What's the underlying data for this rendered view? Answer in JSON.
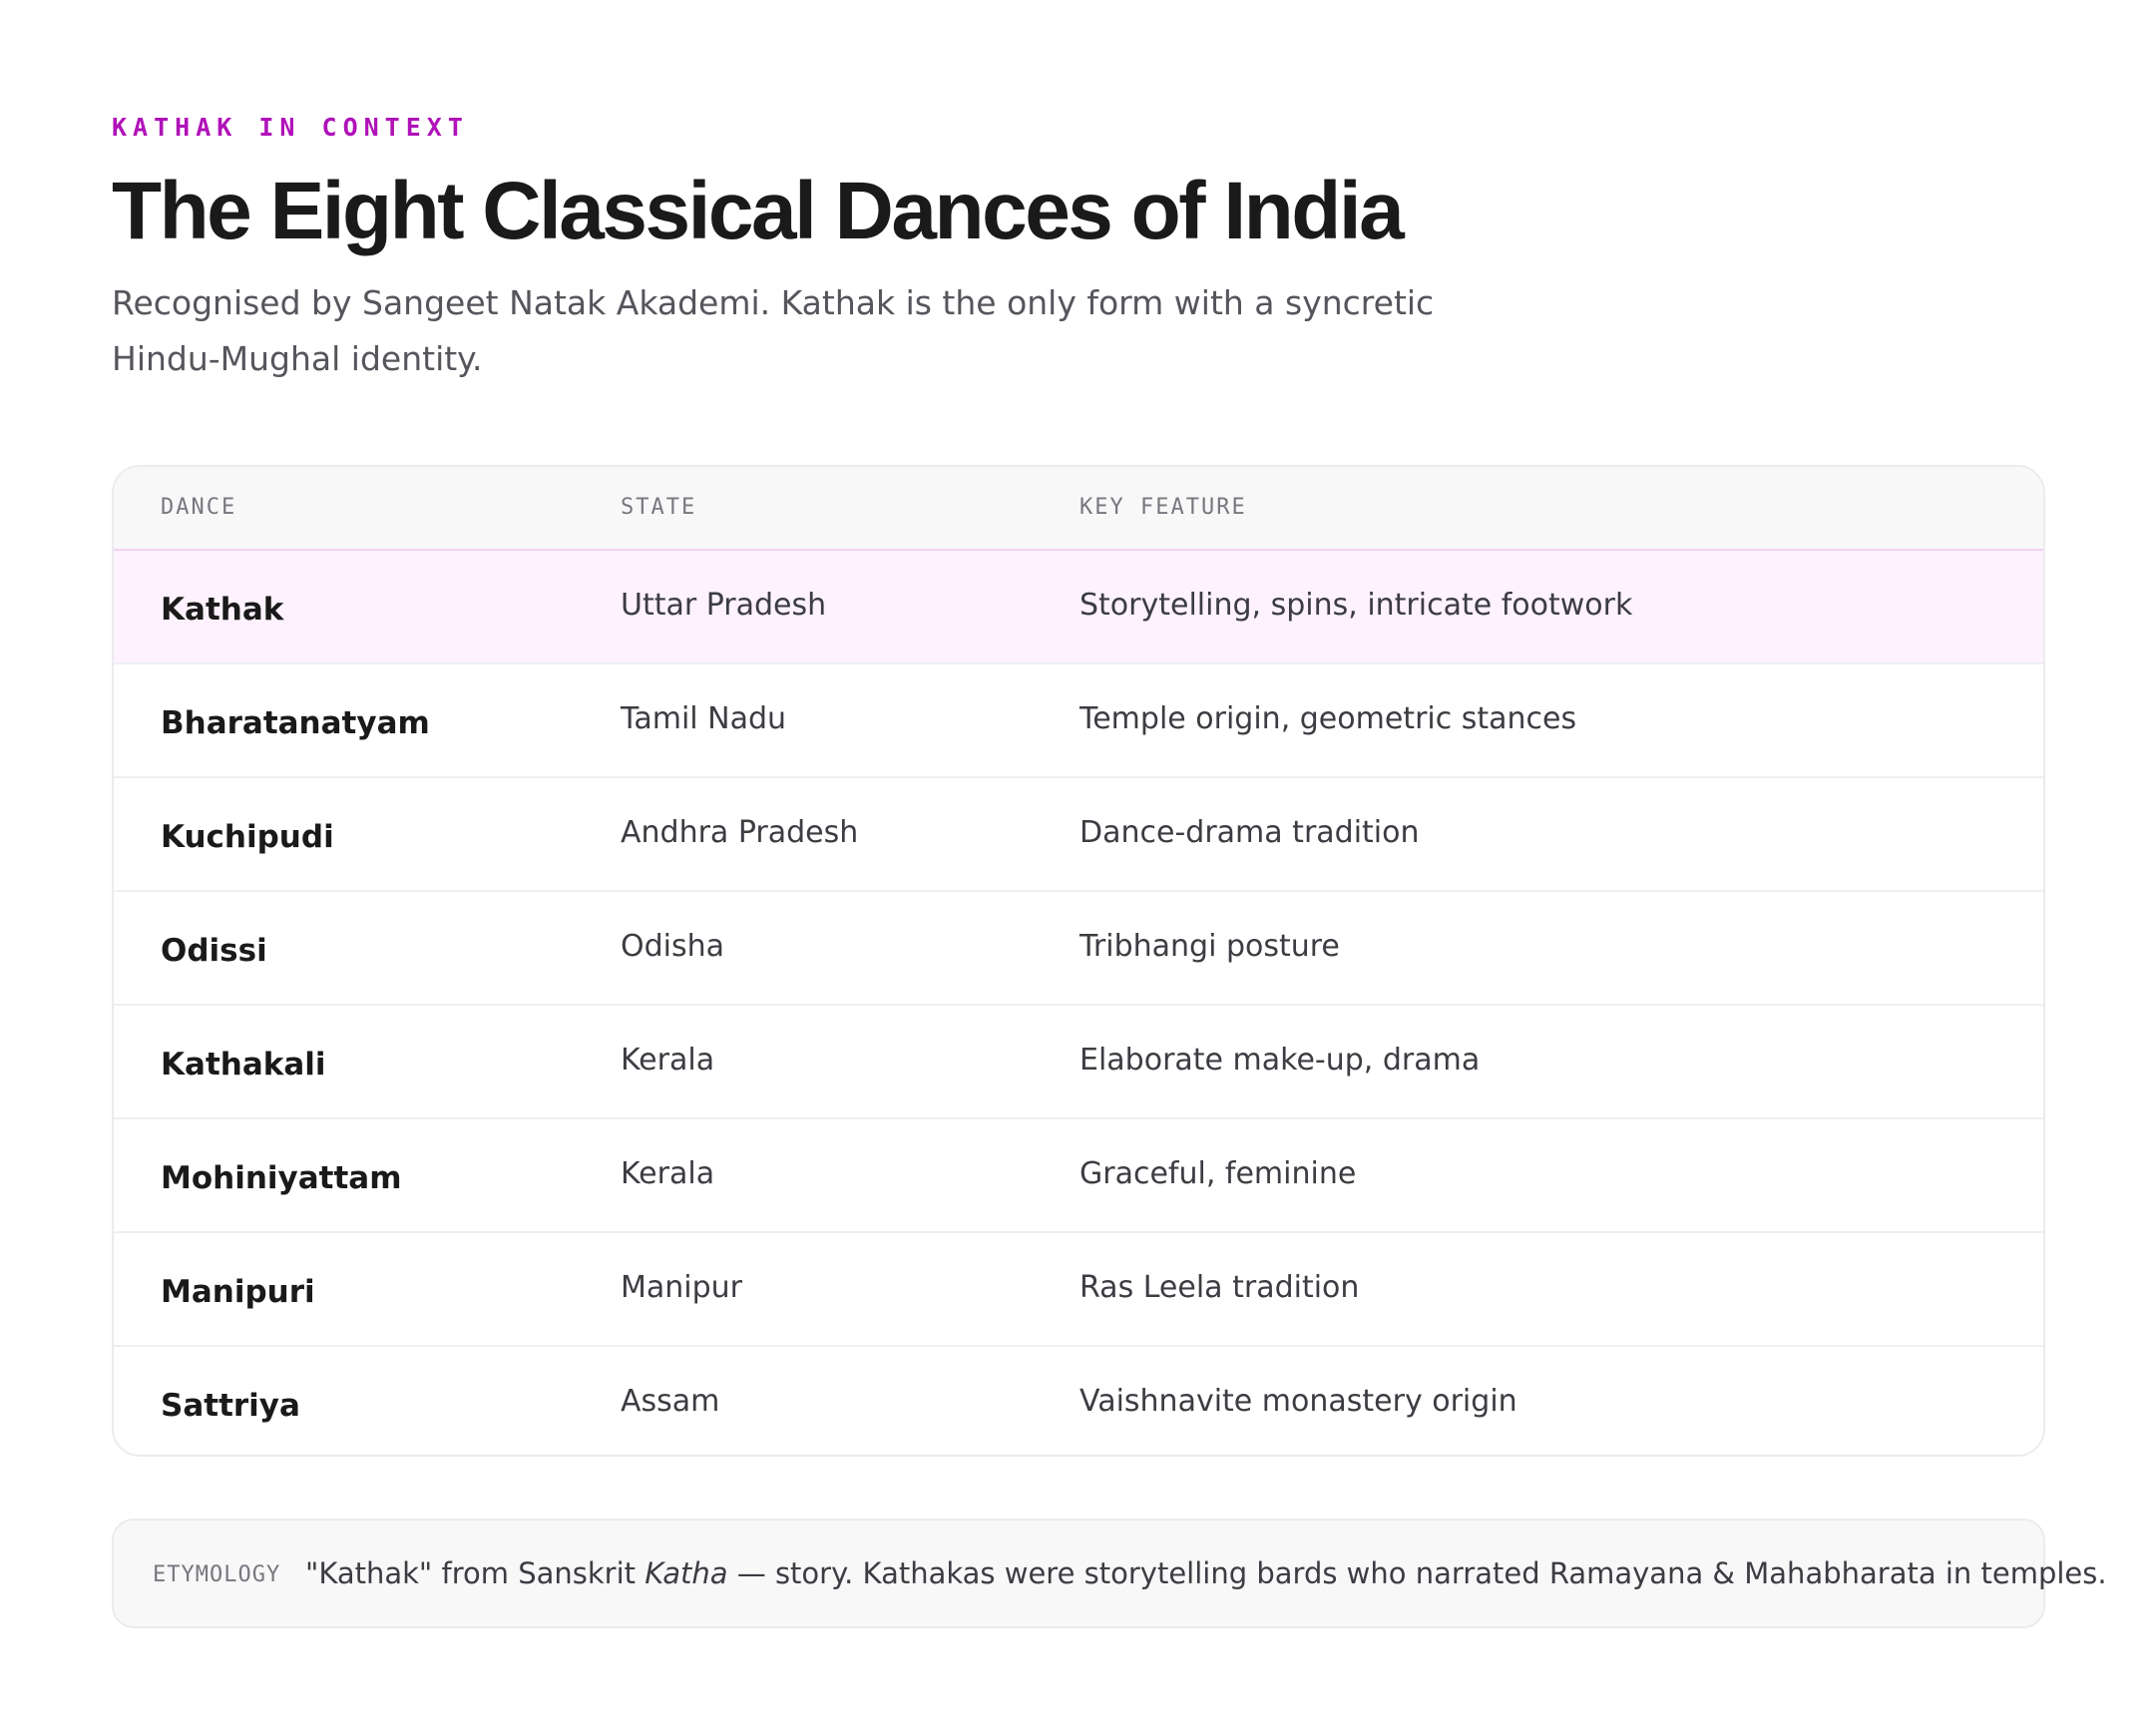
{
  "header": {
    "eyebrow": "KATHAK IN CONTEXT",
    "title": "The Eight Classical Dances of India",
    "subtitle": "Recognised by Sangeet Natak Akademi. Kathak is the only form with a syncretic Hindu-Mughal identity."
  },
  "table": {
    "columns": [
      "DANCE",
      "STATE",
      "KEY FEATURE"
    ],
    "rows": [
      {
        "dance": "Kathak",
        "state": "Uttar Pradesh",
        "feature": "Storytelling, spins, intricate footwork",
        "highlighted": true
      },
      {
        "dance": "Bharatanatyam",
        "state": "Tamil Nadu",
        "feature": "Temple origin, geometric stances"
      },
      {
        "dance": "Kuchipudi",
        "state": "Andhra Pradesh",
        "feature": "Dance-drama tradition"
      },
      {
        "dance": "Odissi",
        "state": "Odisha",
        "feature": "Tribhangi posture"
      },
      {
        "dance": "Kathakali",
        "state": "Kerala",
        "feature": "Elaborate make-up, drama"
      },
      {
        "dance": "Mohiniyattam",
        "state": "Kerala",
        "feature": "Graceful, feminine"
      },
      {
        "dance": "Manipuri",
        "state": "Manipur",
        "feature": "Ras Leela tradition"
      },
      {
        "dance": "Sattriya",
        "state": "Assam",
        "feature": "Vaishnavite monastery origin"
      }
    ]
  },
  "etymology": {
    "label": "ETYMOLOGY",
    "text_before": "\"Kathak\" from Sanskrit ",
    "text_italic": "Katha",
    "text_after": " — story. Kathakas were storytelling bards who narrated Ramayana & Mahabharata in temples."
  },
  "colors": {
    "accent": "#b012b8",
    "highlight_row": "#fdf2fd",
    "text_primary": "#1a1a1a",
    "text_secondary": "#55555c"
  }
}
